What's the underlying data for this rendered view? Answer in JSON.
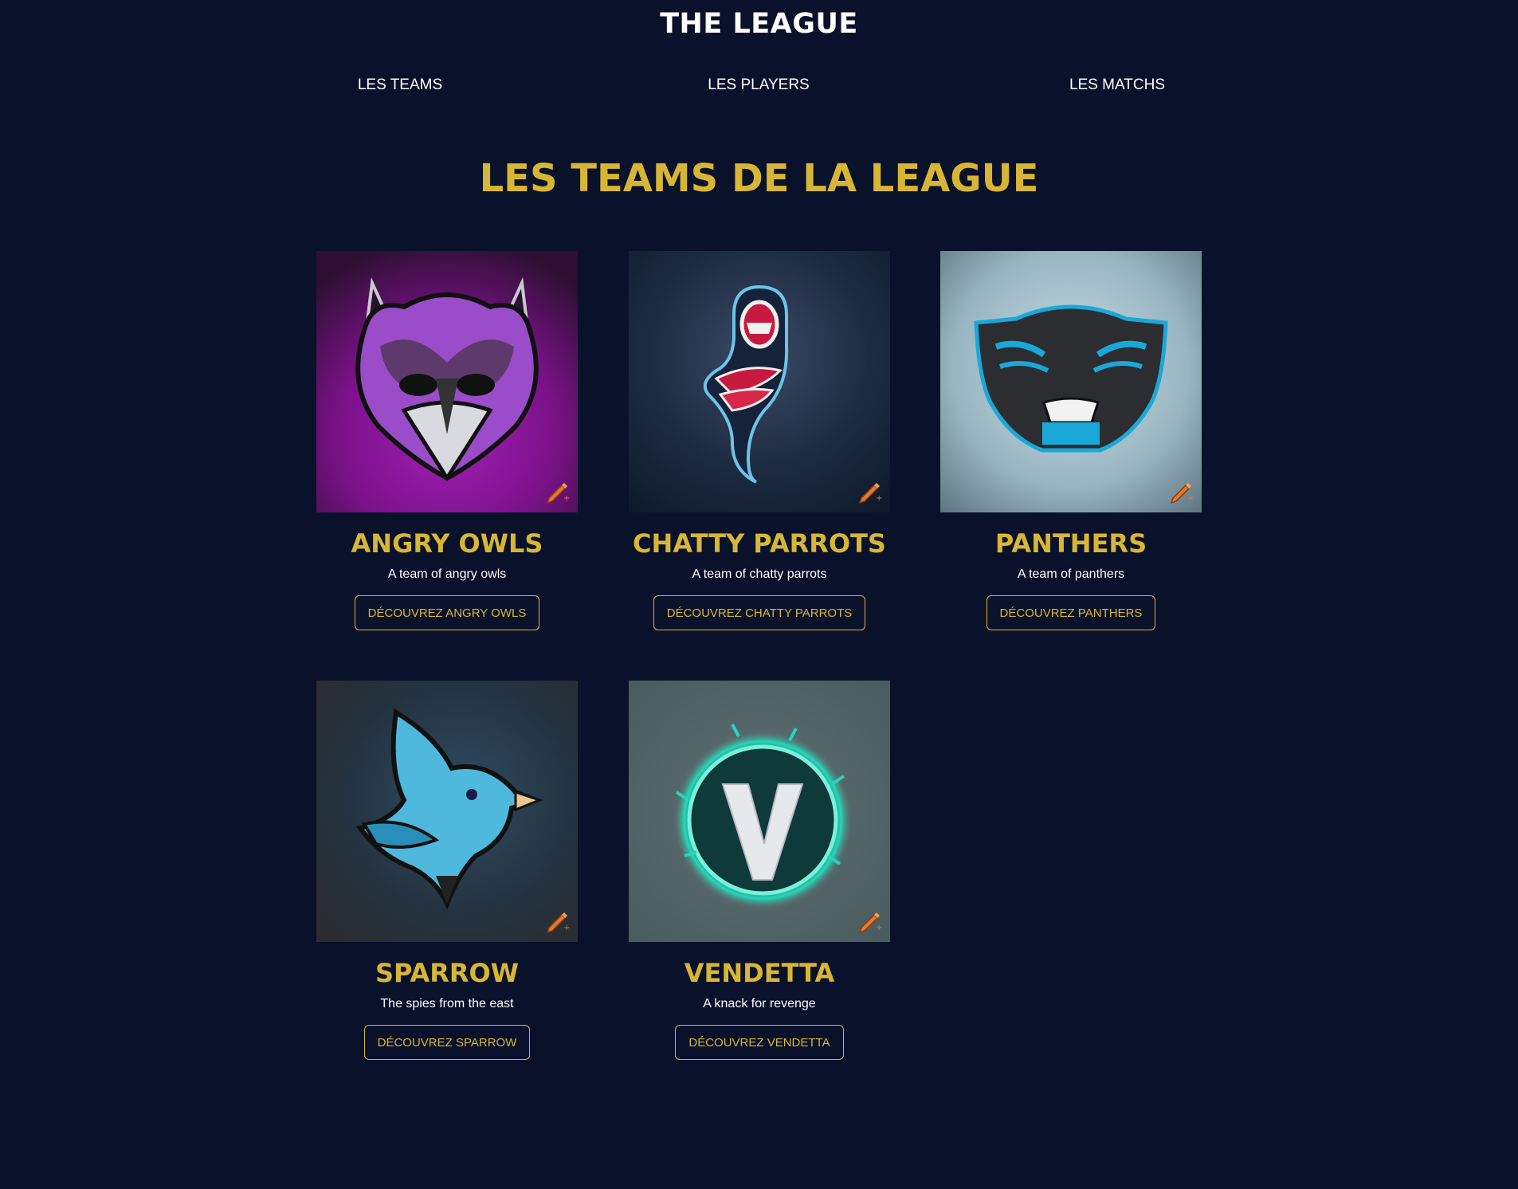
{
  "header": {
    "title": "THE LEAGUE",
    "nav": [
      {
        "label": "LES TEAMS"
      },
      {
        "label": "LES PLAYERS"
      },
      {
        "label": "LES MATCHS"
      }
    ]
  },
  "main": {
    "section_title": "LES TEAMS DE LA LEAGUE",
    "teams": [
      {
        "name": "ANGRY OWLS",
        "description": "A team of angry owls",
        "button_label": "DÉCOUVREZ ANGRY OWLS",
        "logo_icon": "owl-logo-icon"
      },
      {
        "name": "CHATTY PARROTS",
        "description": "A team of chatty parrots",
        "button_label": "DÉCOUVREZ CHATTY PARROTS",
        "logo_icon": "parrot-logo-icon"
      },
      {
        "name": "PANTHERS",
        "description": "A team of panthers",
        "button_label": "DÉCOUVREZ PANTHERS",
        "logo_icon": "panther-logo-icon"
      },
      {
        "name": "SPARROW",
        "description": "The spies from the east",
        "button_label": "DÉCOUVREZ SPARROW",
        "logo_icon": "sparrow-logo-icon"
      },
      {
        "name": "VENDETTA",
        "description": "A knack for revenge",
        "button_label": "DÉCOUVREZ VENDETTA",
        "logo_icon": "vendetta-v-logo-icon"
      }
    ],
    "edit_icon": "pencil-edit-icon"
  },
  "colors": {
    "background": "#0a112a",
    "accent": "#d8b635",
    "text": "#ffffff",
    "edit_icon": "#e8772e"
  }
}
